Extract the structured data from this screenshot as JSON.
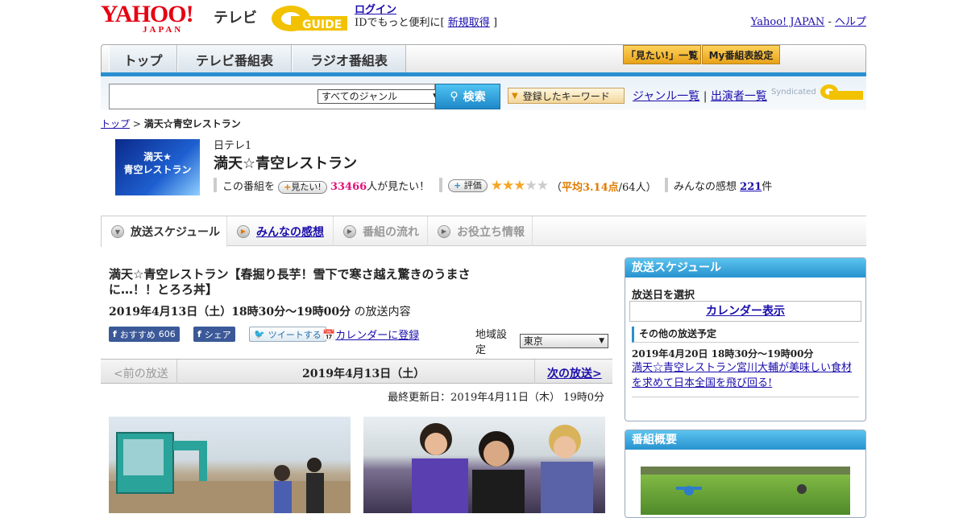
{
  "header": {
    "logo_main": "YAHOO!",
    "logo_sub": "JAPAN",
    "logo_tv": "テレビ",
    "gguide_logo": "GUIDE",
    "login_link": "ログイン",
    "login_text": "IDでもっと便利に[",
    "register_link": "新規取得",
    "login_close": "]",
    "yahoo_japan_link": "Yahoo! JAPAN",
    "dash": "-",
    "help_link": "ヘルプ"
  },
  "nav": {
    "tabs": [
      "トップ",
      "テレビ番組表",
      "ラジオ番組表"
    ],
    "mitai_list": "「見たい!」一覧",
    "my_schedule": "My番組表設定"
  },
  "search": {
    "genre": "すべてのジャンル",
    "button": "検索",
    "keyword_button": "登録したキーワード",
    "genre_list": "ジャンル一覧",
    "divider": "|",
    "cast_list": "出演者一覧",
    "syndicated": "Syndicated"
  },
  "breadcrumb": {
    "top": "トップ",
    "sep": ">",
    "current": "満天☆青空レストラン"
  },
  "program": {
    "thumb_line1": "満天★",
    "thumb_line2": "青空レストラン",
    "channel": "日テレ1",
    "title": "満天☆青空レストラン",
    "this_program": "この番組を",
    "mitai_btn": "見たい!",
    "mitai_count": "33466",
    "mitai_suffix": "人が見たい！",
    "rate_btn": "評価",
    "rating": 3.14,
    "avg_open": "（",
    "avg_label": "平均3.14点",
    "avg_count": "/64人）",
    "impressions_label": "みんなの感想",
    "impressions_count": "221",
    "impressions_unit": "件"
  },
  "subtabs": [
    "放送スケジュール",
    "みんなの感想",
    "番組の流れ",
    "お役立ち情報"
  ],
  "episode": {
    "title": "満天☆青空レストラン【春掘り長芋！雪下で寒さ越え驚きのうまさに…！！とろろ丼】",
    "date": "2019年4月13日（土）18時30分～19時00分",
    "date_suffix": "の放送内容",
    "fb_recommend": "おすすめ",
    "fb_count": "606",
    "fb_share": "シェア",
    "tweet": "ツイートする",
    "calendar_register": "カレンダーに登録",
    "region_label": "地域設定",
    "region_value": "東京",
    "prev": "<前の放送",
    "pager_date": "2019年4月13日（土）",
    "next": "次の放送>",
    "updated": "最終更新日：2019年4月11日（木） 19時0分"
  },
  "sidebar": {
    "schedule_head": "放送スケジュール",
    "select_date": "放送日を選択",
    "calendar_link": "カレンダー表示",
    "other_head": "その他の放送予定",
    "other_date": "2019年4月20日 18時30分～19時00分",
    "other_link": "満天☆青空レストラン宮川大輔が美味しい食材を求めて日本全国を飛び回る!",
    "summary_head": "番組概要"
  },
  "colors": {
    "accent_blue": "#2a8fd0",
    "yahoo_red": "#e60012",
    "mitai_pink": "#e0137a",
    "avg_orange": "#e07b00"
  }
}
